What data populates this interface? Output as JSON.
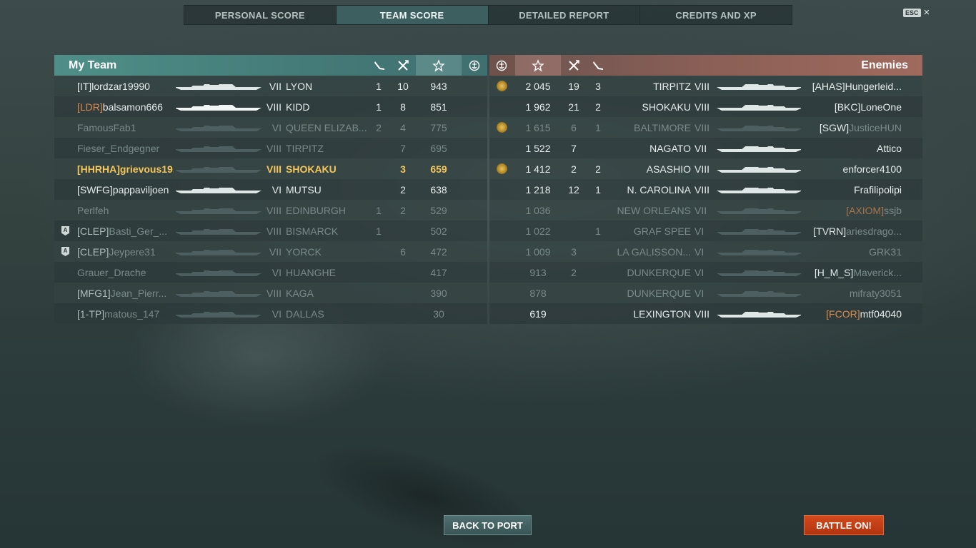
{
  "tabs": [
    "PERSONAL SCORE",
    "TEAM SCORE",
    "DETAILED REPORT",
    "CREDITS AND XP"
  ],
  "active_tab": "TEAM SCORE",
  "esc_label": "ESC",
  "close_glyph": "×",
  "my_team": {
    "title": "My Team",
    "header_icons": [
      "plane-icon",
      "crossed-guns-icon",
      "star-icon",
      "base-capture-icon"
    ],
    "rows": [
      {
        "clan": "[IT]",
        "clan_color": "default",
        "name": "lordzar19990",
        "tier": "VII",
        "ship": "LYON",
        "planes": "1",
        "kills": "10",
        "score": "943",
        "state": "alive",
        "badge": ""
      },
      {
        "clan": "[LDR]",
        "clan_color": "orange",
        "name": "balsamon666",
        "tier": "VIII",
        "ship": "KIDD",
        "planes": "1",
        "kills": "8",
        "score": "851",
        "state": "alive-bright",
        "badge": ""
      },
      {
        "clan": "",
        "clan_color": "default",
        "name": "FamousFab1",
        "tier": "VI",
        "ship": "QUEEN ELIZAB...",
        "planes": "2",
        "kills": "4",
        "score": "775",
        "state": "dead",
        "badge": ""
      },
      {
        "clan": "",
        "clan_color": "default",
        "name": "Fieser_Endgegner",
        "tier": "VIII",
        "ship": "TIRPITZ",
        "planes": "",
        "kills": "7",
        "score": "695",
        "state": "dead",
        "badge": ""
      },
      {
        "clan": "[HHRHA]",
        "clan_color": "default",
        "name": "grievous19...",
        "tier": "VIII",
        "ship": "SHOKAKU",
        "planes": "",
        "kills": "3",
        "score": "659",
        "state": "me",
        "badge": ""
      },
      {
        "clan": "[SWFG]",
        "clan_color": "default",
        "name": "pappaviljoen",
        "tier": "VI",
        "ship": "MUTSU",
        "planes": "",
        "kills": "2",
        "score": "638",
        "state": "alive",
        "badge": ""
      },
      {
        "clan": "",
        "clan_color": "default",
        "name": "Perlfeh",
        "tier": "VIII",
        "ship": "EDINBURGH",
        "planes": "1",
        "kills": "2",
        "score": "529",
        "state": "dead",
        "badge": ""
      },
      {
        "clan": "[CLEP]",
        "clan_color": "default",
        "name": "Basti_Ger_...",
        "tier": "VIII",
        "ship": "BISMARCK",
        "planes": "1",
        "kills": "",
        "score": "502",
        "state": "dead-partial",
        "badge": "A"
      },
      {
        "clan": "[CLEP]",
        "clan_color": "default",
        "name": "Jeypere31",
        "tier": "VII",
        "ship": "YORCK",
        "planes": "",
        "kills": "6",
        "score": "472",
        "state": "dead-partial",
        "badge": "A"
      },
      {
        "clan": "",
        "clan_color": "default",
        "name": "Grauer_Drache",
        "tier": "VI",
        "ship": "HUANGHE",
        "planes": "",
        "kills": "",
        "score": "417",
        "state": "dead",
        "badge": ""
      },
      {
        "clan": "[MFG1]",
        "clan_color": "default",
        "name": "Jean_Pierr...",
        "tier": "VIII",
        "ship": "KAGA",
        "planes": "",
        "kills": "",
        "score": "390",
        "state": "dead-partial",
        "badge": ""
      },
      {
        "clan": "[1-TP]",
        "clan_color": "default",
        "name": "matous_147",
        "tier": "VI",
        "ship": "DALLAS",
        "planes": "",
        "kills": "",
        "score": "30",
        "state": "dead-partial",
        "badge": ""
      }
    ]
  },
  "enemies": {
    "title": "Enemies",
    "header_icons": [
      "base-capture-icon",
      "star-icon",
      "crossed-guns-icon",
      "plane-icon"
    ],
    "rows": [
      {
        "medal": true,
        "score": "2 045",
        "kills": "19",
        "planes": "3",
        "ship": "TIRPITZ",
        "tier": "VIII",
        "clan": "[AHAS]",
        "clan_color": "default",
        "name": "Hungerleid...",
        "state": "alive"
      },
      {
        "medal": false,
        "score": "1 962",
        "kills": "21",
        "planes": "2",
        "ship": "SHOKAKU",
        "tier": "VIII",
        "clan": "[BKC]",
        "clan_color": "default",
        "name": "LoneOne",
        "state": "alive"
      },
      {
        "medal": true,
        "score": "1 615",
        "kills": "6",
        "planes": "1",
        "ship": "BALTIMORE",
        "tier": "VIII",
        "clan": "[SGW]",
        "clan_color": "default",
        "name": "JusticeHUN",
        "state": "dead"
      },
      {
        "medal": false,
        "score": "1 522",
        "kills": "7",
        "planes": "",
        "ship": "NAGATO",
        "tier": "VII",
        "clan": "",
        "clan_color": "default",
        "name": "Attico",
        "state": "alive"
      },
      {
        "medal": true,
        "score": "1 412",
        "kills": "2",
        "planes": "2",
        "ship": "ASASHIO",
        "tier": "VIII",
        "clan": "",
        "clan_color": "default",
        "name": "enforcer4100",
        "state": "alive"
      },
      {
        "medal": false,
        "score": "1 218",
        "kills": "12",
        "planes": "1",
        "ship": "N. CAROLINA",
        "tier": "VIII",
        "clan": "",
        "clan_color": "default",
        "name": "Frafilipolipi",
        "state": "alive"
      },
      {
        "medal": false,
        "score": "1 036",
        "kills": "",
        "planes": "",
        "ship": "NEW ORLEANS",
        "tier": "VII",
        "clan": "[AXIOM]",
        "clan_color": "orange",
        "name": "ssjb",
        "state": "dead"
      },
      {
        "medal": false,
        "score": "1 022",
        "kills": "",
        "planes": "1",
        "ship": "GRAF SPEE",
        "tier": "VI",
        "clan": "[TVRN]",
        "clan_color": "default",
        "name": "ariesdrago...",
        "state": "dead"
      },
      {
        "medal": false,
        "score": "1 009",
        "kills": "3",
        "planes": "",
        "ship": "LA GALISSON...",
        "tier": "VI",
        "clan": "",
        "clan_color": "default",
        "name": "GRK31",
        "state": "dead"
      },
      {
        "medal": false,
        "score": "913",
        "kills": "2",
        "planes": "",
        "ship": "DUNKERQUE",
        "tier": "VI",
        "clan": "[H_M_S]",
        "clan_color": "default",
        "name": "Maverick...",
        "state": "dead"
      },
      {
        "medal": false,
        "score": "878",
        "kills": "",
        "planes": "",
        "ship": "DUNKERQUE",
        "tier": "VI",
        "clan": "",
        "clan_color": "default",
        "name": "mifraty3051",
        "state": "dead"
      },
      {
        "medal": false,
        "score": "619",
        "kills": "",
        "planes": "",
        "ship": "LEXINGTON",
        "tier": "VIII",
        "clan": "[FCOR]",
        "clan_color": "orange",
        "name": "mtf04040",
        "state": "alive"
      }
    ]
  },
  "buttons": {
    "back": "BACK TO PORT",
    "battle": "BATTLE ON!"
  }
}
